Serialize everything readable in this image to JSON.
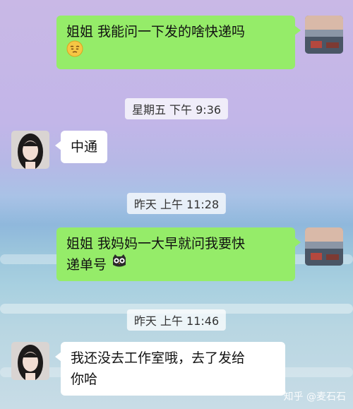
{
  "messages": [
    {
      "side": "right",
      "text_line1": "姐姐 我能问一下发的啥快递吗",
      "emoji": "pensive-face"
    },
    {
      "side": "left",
      "text": "中通"
    },
    {
      "side": "right",
      "text_line1": "姐姐 我妈妈一大早就问我要快",
      "text_line2": "递单号",
      "emoji": "owl-face"
    },
    {
      "side": "left",
      "text_line1": "我还没去工作室哦，去了发给",
      "text_line2": "你哈"
    }
  ],
  "timestamps": [
    "星期五 下午 9:36",
    "昨天 上午 11:28",
    "昨天 上午 11:46"
  ],
  "watermark": "知乎 @麦石石",
  "colors": {
    "green_bubble": "#95ec69",
    "white_bubble": "#ffffff"
  }
}
